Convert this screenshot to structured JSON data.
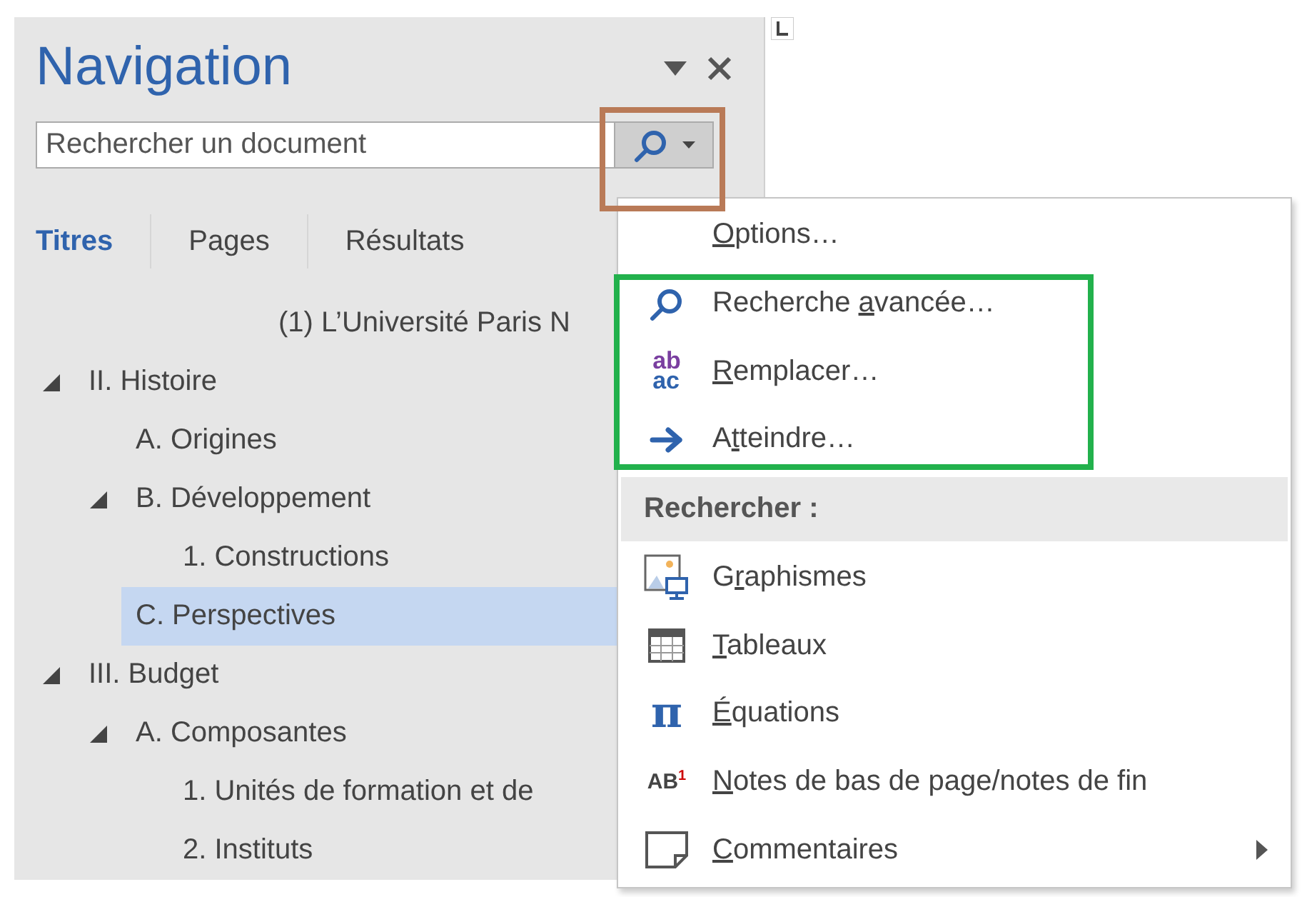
{
  "pane": {
    "title": "Navigation",
    "search": {
      "placeholder": "Rechercher un document"
    },
    "tabs": [
      {
        "label": "Titres",
        "selected": true
      },
      {
        "label": "Pages",
        "selected": false
      },
      {
        "label": "Résultats",
        "selected": false
      }
    ],
    "tree": [
      {
        "kind": "title",
        "label": "(1) L’Université Paris N",
        "selected": false
      },
      {
        "kind": "heading",
        "label": "II. Histoire",
        "expanded": true,
        "selected": false,
        "children": [
          {
            "label": "A. Origines",
            "selected": false
          },
          {
            "label": "B. Développement",
            "expanded": true,
            "selected": false,
            "children": [
              {
                "label": "1. Constructions",
                "selected": false
              }
            ]
          },
          {
            "label": "C. Perspectives",
            "selected": true
          }
        ]
      },
      {
        "kind": "heading",
        "label": "III. Budget",
        "expanded": true,
        "selected": false,
        "children": [
          {
            "label": "A. Composantes",
            "expanded": true,
            "selected": false,
            "children": [
              {
                "label": "1. Unités de formation et de",
                "selected": false
              },
              {
                "label": "2. Instituts",
                "selected": false
              }
            ]
          }
        ]
      }
    ]
  },
  "menu": {
    "items": [
      {
        "kind": "command",
        "icon": {
          "kind": "none"
        },
        "key": "O",
        "after": "ptions…",
        "has_submenu": false
      },
      {
        "kind": "command",
        "icon": {
          "kind": "search"
        },
        "before": "Recherche ",
        "key": "a",
        "after": "vancée…",
        "has_submenu": false
      },
      {
        "kind": "command",
        "icon": {
          "kind": "replace",
          "text": [
            "ab",
            "ac"
          ]
        },
        "key": "R",
        "after": "emplacer…",
        "has_submenu": false
      },
      {
        "kind": "command",
        "icon": {
          "kind": "arrow"
        },
        "before": "A",
        "key": "t",
        "after": "teindre…",
        "has_submenu": false
      },
      {
        "kind": "header",
        "label": "Rechercher :"
      },
      {
        "kind": "command",
        "icon": {
          "kind": "graphics"
        },
        "before": "G",
        "key": "r",
        "after": "aphismes",
        "has_submenu": false
      },
      {
        "kind": "command",
        "icon": {
          "kind": "table"
        },
        "key": "T",
        "after": "ableaux",
        "has_submenu": false
      },
      {
        "kind": "command",
        "icon": {
          "kind": "symbol",
          "text": "π"
        },
        "key": "É",
        "after": "quations",
        "has_submenu": false
      },
      {
        "kind": "command",
        "icon": {
          "kind": "footnote",
          "text": "AB",
          "mark": "1"
        },
        "key": "N",
        "after": "otes de bas de page/notes de fin",
        "has_submenu": false
      },
      {
        "kind": "command",
        "icon": {
          "kind": "comment"
        },
        "key": "C",
        "after": "ommentaires",
        "has_submenu": true
      }
    ]
  }
}
